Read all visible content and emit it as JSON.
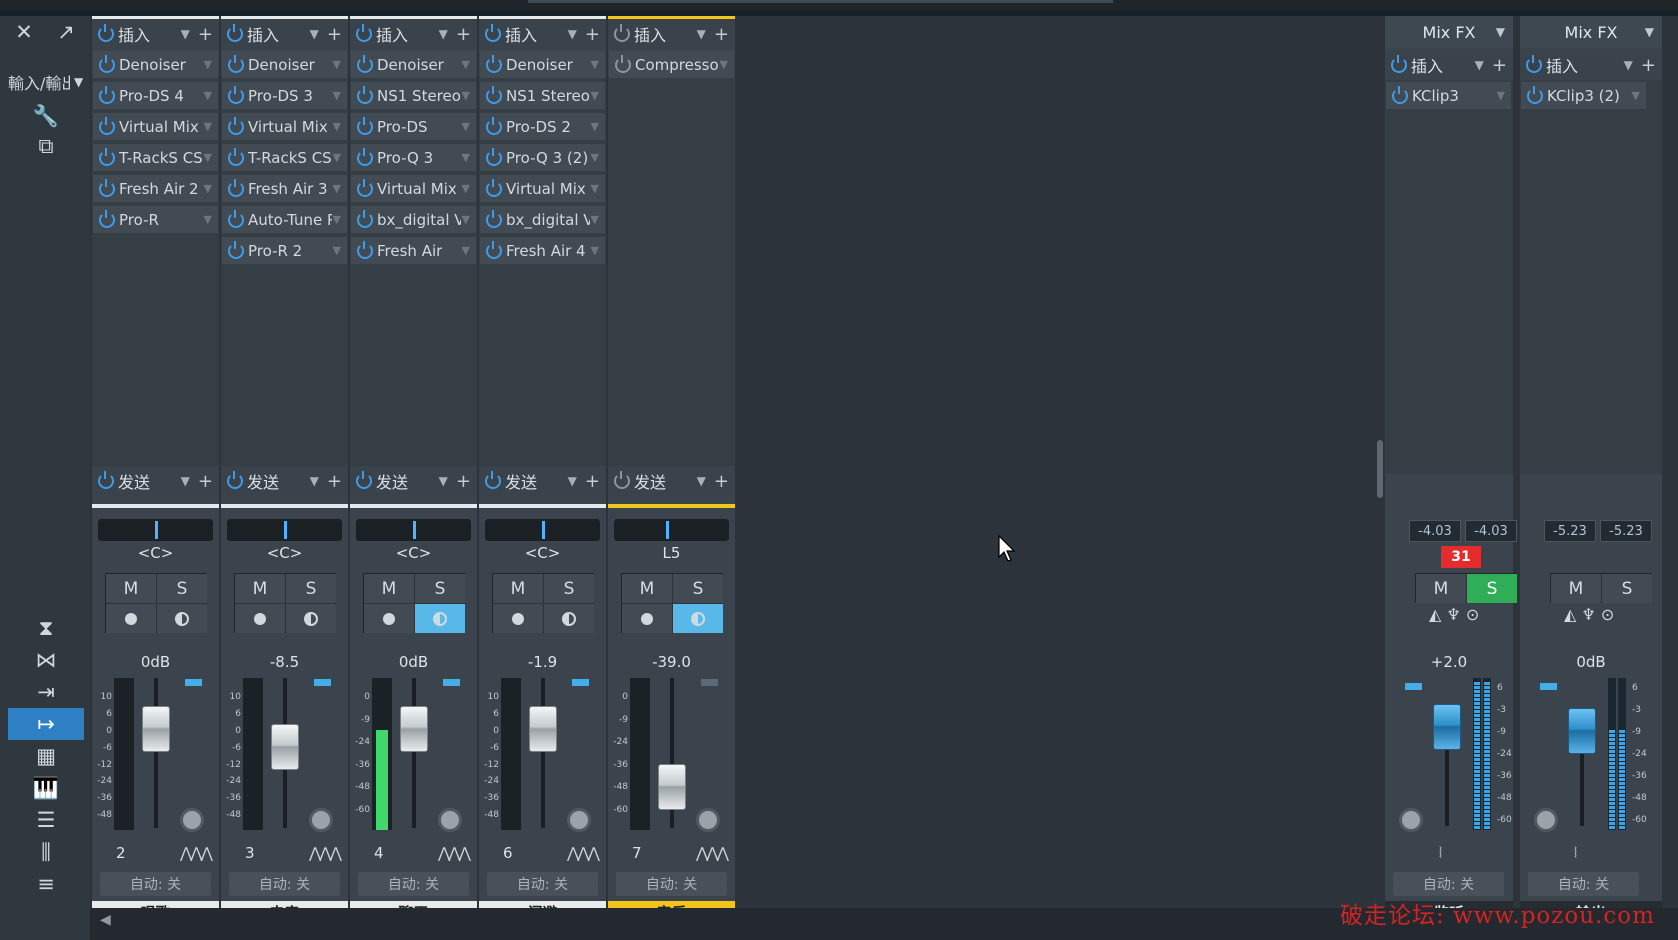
{
  "left_toolbar": {
    "close": "✕",
    "expand": "↗",
    "io_label": "輸入/輸出",
    "io_dropdown": "▼"
  },
  "channels": [
    {
      "id": "ch2",
      "number": "2",
      "name": "唱歌",
      "selected": false,
      "insert_label": "插入",
      "send_label": "发送",
      "pan": "<C>",
      "volume": "0dB",
      "solo": false,
      "monitor": false,
      "auto": "自动: 关",
      "plugins": [
        "Denoiser",
        "Pro-DS 4",
        "Virtual Mix R...",
        "T-RackS CS...",
        "Fresh Air 2",
        "Pro-R"
      ]
    },
    {
      "id": "ch3",
      "number": "3",
      "name": "电音",
      "selected": false,
      "insert_label": "插入",
      "send_label": "发送",
      "pan": "<C>",
      "volume": "-8.5",
      "solo": false,
      "monitor": false,
      "auto": "自动: 关",
      "plugins": [
        "Denoiser",
        "Pro-DS 3",
        "Virtual Mix R...",
        "T-RackS CS...",
        "Fresh Air 3",
        "Auto-Tune Pr...",
        "Pro-R 2"
      ]
    },
    {
      "id": "ch4",
      "number": "4",
      "name": "聊天",
      "selected": false,
      "insert_label": "插入",
      "send_label": "发送",
      "pan": "<C>",
      "volume": "0dB",
      "solo": false,
      "monitor": true,
      "auto": "自动: 关",
      "plugins": [
        "Denoiser",
        "NS1 Stereo",
        "Pro-DS",
        "Pro-Q 3",
        "Virtual Mix R...",
        "bx_digital V3...",
        "Fresh Air"
      ]
    },
    {
      "id": "ch6",
      "number": "6",
      "name": "闪避",
      "selected": false,
      "insert_label": "插入",
      "send_label": "发送",
      "pan": "<C>",
      "volume": "-1.9",
      "solo": false,
      "monitor": false,
      "auto": "自动: 关",
      "plugins": [
        "Denoiser",
        "NS1 Stereo",
        "Pro-DS 2",
        "Pro-Q 3 (2)",
        "Virtual Mix R...",
        "bx_digital V3...",
        "Fresh Air 4"
      ]
    },
    {
      "id": "ch7",
      "number": "7",
      "name": "音乐",
      "selected": true,
      "insert_label": "插入",
      "send_label": "发送",
      "pan": "L5",
      "volume": "-39.0",
      "solo": false,
      "monitor": true,
      "auto": "自动: 关",
      "plugins": [
        "Compressor"
      ]
    }
  ],
  "buses": [
    {
      "id": "monitor",
      "name": "监听",
      "mixfx": "Mix FX",
      "insert_label": "插入",
      "plugins": [
        "KClip3"
      ],
      "peak_l": "-4.03",
      "peak_r": "-4.03",
      "clip": "31",
      "volume": "+2.0",
      "solo": true,
      "auto": "自动: 关"
    },
    {
      "id": "output",
      "name": "输出",
      "mixfx": "Mix FX",
      "insert_label": "插入",
      "plugins": [
        "KClip3 (2)"
      ],
      "peak_l": "-5.23",
      "peak_r": "-5.23",
      "volume": "0dB",
      "solo": false,
      "auto": "自动: 关"
    }
  ],
  "labels": {
    "mute": "M",
    "solo": "S"
  },
  "meter_scale": [
    "10",
    "6",
    "0",
    "-6",
    "-12",
    "-24",
    "-36",
    "-48"
  ],
  "meter_scale_ch4": [
    "0",
    "-9",
    "-24",
    "-36",
    "-48",
    "-60"
  ],
  "bus_scale": [
    "6",
    "-3",
    "-9",
    "-24",
    "-36",
    "-48",
    "-60"
  ],
  "watermark": "破走论坛: www.pozou.com",
  "colors": {
    "accent": "#2f7fc5",
    "selected": "#f2c71c",
    "solo_on": "#2fae57",
    "clip": "#e52c2c",
    "power": "#3f9be8"
  }
}
